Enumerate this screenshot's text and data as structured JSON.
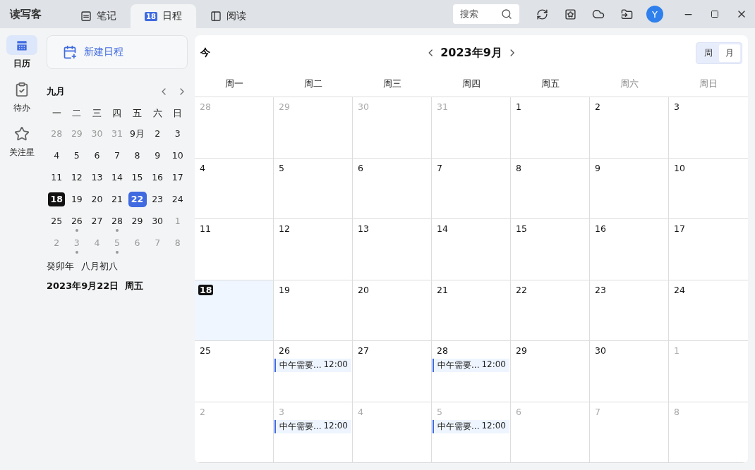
{
  "app": {
    "title": "读写客"
  },
  "tabs": [
    {
      "label": "笔记",
      "kind": "note",
      "selected": false
    },
    {
      "label": "日程",
      "kind": "date",
      "badge": "18",
      "selected": true
    },
    {
      "label": "阅读",
      "kind": "book",
      "selected": false
    }
  ],
  "search": {
    "placeholder": "搜索"
  },
  "avatar": {
    "letter": "Y"
  },
  "nav": [
    {
      "label": "日历",
      "kind": "calendar",
      "selected": true
    },
    {
      "label": "待办",
      "kind": "todo",
      "selected": false
    },
    {
      "label": "关注星",
      "kind": "star",
      "selected": false
    }
  ],
  "new_button": {
    "label": "新建日程"
  },
  "mini": {
    "month": "九月",
    "weekdays": [
      "一",
      "二",
      "三",
      "四",
      "五",
      "六",
      "日"
    ],
    "days": [
      {
        "d": "28",
        "muted": true,
        "today": false,
        "selected": false,
        "dot": false
      },
      {
        "d": "29",
        "muted": true,
        "today": false,
        "selected": false,
        "dot": false
      },
      {
        "d": "30",
        "muted": true,
        "today": false,
        "selected": false,
        "dot": false
      },
      {
        "d": "31",
        "muted": true,
        "today": false,
        "selected": false,
        "dot": false
      },
      {
        "d": "9月",
        "muted": false,
        "today": false,
        "selected": false,
        "dot": false
      },
      {
        "d": "2",
        "muted": false,
        "today": false,
        "selected": false,
        "dot": false
      },
      {
        "d": "3",
        "muted": false,
        "today": false,
        "selected": false,
        "dot": false
      },
      {
        "d": "4",
        "muted": false,
        "today": false,
        "selected": false,
        "dot": false
      },
      {
        "d": "5",
        "muted": false,
        "today": false,
        "selected": false,
        "dot": false
      },
      {
        "d": "6",
        "muted": false,
        "today": false,
        "selected": false,
        "dot": false
      },
      {
        "d": "7",
        "muted": false,
        "today": false,
        "selected": false,
        "dot": false
      },
      {
        "d": "8",
        "muted": false,
        "today": false,
        "selected": false,
        "dot": false
      },
      {
        "d": "9",
        "muted": false,
        "today": false,
        "selected": false,
        "dot": false
      },
      {
        "d": "10",
        "muted": false,
        "today": false,
        "selected": false,
        "dot": false
      },
      {
        "d": "11",
        "muted": false,
        "today": false,
        "selected": false,
        "dot": false
      },
      {
        "d": "12",
        "muted": false,
        "today": false,
        "selected": false,
        "dot": false
      },
      {
        "d": "13",
        "muted": false,
        "today": false,
        "selected": false,
        "dot": false
      },
      {
        "d": "14",
        "muted": false,
        "today": false,
        "selected": false,
        "dot": false
      },
      {
        "d": "15",
        "muted": false,
        "today": false,
        "selected": false,
        "dot": false
      },
      {
        "d": "16",
        "muted": false,
        "today": false,
        "selected": false,
        "dot": false
      },
      {
        "d": "17",
        "muted": false,
        "today": false,
        "selected": false,
        "dot": false
      },
      {
        "d": "18",
        "muted": false,
        "today": true,
        "selected": false,
        "dot": false
      },
      {
        "d": "19",
        "muted": false,
        "today": false,
        "selected": false,
        "dot": false
      },
      {
        "d": "20",
        "muted": false,
        "today": false,
        "selected": false,
        "dot": false
      },
      {
        "d": "21",
        "muted": false,
        "today": false,
        "selected": false,
        "dot": false
      },
      {
        "d": "22",
        "muted": false,
        "today": false,
        "selected": true,
        "dot": false
      },
      {
        "d": "23",
        "muted": false,
        "today": false,
        "selected": false,
        "dot": false
      },
      {
        "d": "24",
        "muted": false,
        "today": false,
        "selected": false,
        "dot": false
      },
      {
        "d": "25",
        "muted": false,
        "today": false,
        "selected": false,
        "dot": false
      },
      {
        "d": "26",
        "muted": false,
        "today": false,
        "selected": false,
        "dot": true
      },
      {
        "d": "27",
        "muted": false,
        "today": false,
        "selected": false,
        "dot": false
      },
      {
        "d": "28",
        "muted": false,
        "today": false,
        "selected": false,
        "dot": true
      },
      {
        "d": "29",
        "muted": false,
        "today": false,
        "selected": false,
        "dot": false
      },
      {
        "d": "30",
        "muted": false,
        "today": false,
        "selected": false,
        "dot": false
      },
      {
        "d": "1",
        "muted": true,
        "today": false,
        "selected": false,
        "dot": false
      },
      {
        "d": "2",
        "muted": true,
        "today": false,
        "selected": false,
        "dot": false
      },
      {
        "d": "3",
        "muted": true,
        "today": false,
        "selected": false,
        "dot": true
      },
      {
        "d": "4",
        "muted": true,
        "today": false,
        "selected": false,
        "dot": false
      },
      {
        "d": "5",
        "muted": true,
        "today": false,
        "selected": false,
        "dot": true
      },
      {
        "d": "6",
        "muted": true,
        "today": false,
        "selected": false,
        "dot": false
      },
      {
        "d": "7",
        "muted": true,
        "today": false,
        "selected": false,
        "dot": false
      },
      {
        "d": "8",
        "muted": true,
        "today": false,
        "selected": false,
        "dot": false
      }
    ],
    "lunar": [
      "癸卯年",
      "八月初八"
    ],
    "date": "2023年9月22日  周五"
  },
  "calendar": {
    "today_button": "今",
    "title": "2023年9月",
    "views": [
      {
        "label": "周",
        "selected": false
      },
      {
        "label": "月",
        "selected": true
      }
    ],
    "weekdays": [
      {
        "label": "周一",
        "weekend": false
      },
      {
        "label": "周二",
        "weekend": false
      },
      {
        "label": "周三",
        "weekend": false
      },
      {
        "label": "周四",
        "weekend": false
      },
      {
        "label": "周五",
        "weekend": false
      },
      {
        "label": "周六",
        "weekend": true
      },
      {
        "label": "周日",
        "weekend": true
      }
    ],
    "days": [
      {
        "d": "28",
        "muted": true,
        "today": false
      },
      {
        "d": "29",
        "muted": true,
        "today": false
      },
      {
        "d": "30",
        "muted": true,
        "today": false
      },
      {
        "d": "31",
        "muted": true,
        "today": false
      },
      {
        "d": "1",
        "muted": false,
        "today": false
      },
      {
        "d": "2",
        "muted": false,
        "today": false
      },
      {
        "d": "3",
        "muted": false,
        "today": false
      },
      {
        "d": "4",
        "muted": false,
        "today": false
      },
      {
        "d": "5",
        "muted": false,
        "today": false
      },
      {
        "d": "6",
        "muted": false,
        "today": false
      },
      {
        "d": "7",
        "muted": false,
        "today": false
      },
      {
        "d": "8",
        "muted": false,
        "today": false
      },
      {
        "d": "9",
        "muted": false,
        "today": false
      },
      {
        "d": "10",
        "muted": false,
        "today": false
      },
      {
        "d": "11",
        "muted": false,
        "today": false
      },
      {
        "d": "12",
        "muted": false,
        "today": false
      },
      {
        "d": "13",
        "muted": false,
        "today": false
      },
      {
        "d": "14",
        "muted": false,
        "today": false
      },
      {
        "d": "15",
        "muted": false,
        "today": false
      },
      {
        "d": "16",
        "muted": false,
        "today": false
      },
      {
        "d": "17",
        "muted": false,
        "today": false
      },
      {
        "d": "18",
        "muted": false,
        "today": true
      },
      {
        "d": "19",
        "muted": false,
        "today": false
      },
      {
        "d": "20",
        "muted": false,
        "today": false
      },
      {
        "d": "21",
        "muted": false,
        "today": false
      },
      {
        "d": "22",
        "muted": false,
        "today": false
      },
      {
        "d": "23",
        "muted": false,
        "today": false
      },
      {
        "d": "24",
        "muted": false,
        "today": false
      },
      {
        "d": "25",
        "muted": false,
        "today": false
      },
      {
        "d": "26",
        "muted": false,
        "today": false,
        "events": [
          {
            "title": "中午需要...",
            "time": "12:00"
          }
        ]
      },
      {
        "d": "27",
        "muted": false,
        "today": false
      },
      {
        "d": "28",
        "muted": false,
        "today": false,
        "events": [
          {
            "title": "中午需要...",
            "time": "12:00"
          }
        ]
      },
      {
        "d": "29",
        "muted": false,
        "today": false
      },
      {
        "d": "30",
        "muted": false,
        "today": false
      },
      {
        "d": "1",
        "muted": true,
        "today": false
      },
      {
        "d": "2",
        "muted": true,
        "today": false
      },
      {
        "d": "3",
        "muted": true,
        "today": false,
        "events": [
          {
            "title": "中午需要...",
            "time": "12:00"
          }
        ]
      },
      {
        "d": "4",
        "muted": true,
        "today": false
      },
      {
        "d": "5",
        "muted": true,
        "today": false,
        "events": [
          {
            "title": "中午需要...",
            "time": "12:00"
          }
        ]
      },
      {
        "d": "6",
        "muted": true,
        "today": false
      },
      {
        "d": "7",
        "muted": true,
        "today": false
      },
      {
        "d": "8",
        "muted": true,
        "today": false
      }
    ]
  }
}
